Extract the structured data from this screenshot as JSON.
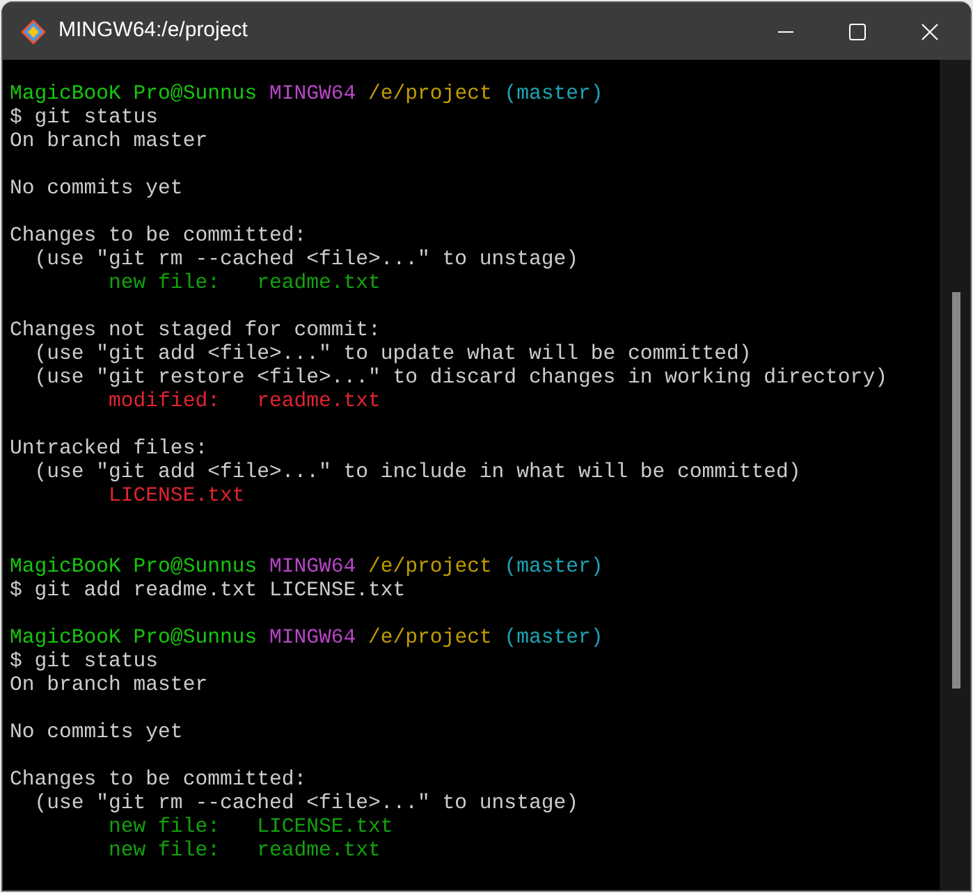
{
  "window": {
    "title": "MINGW64:/e/project"
  },
  "terminal": {
    "lines": [
      {
        "kind": "blank"
      },
      {
        "kind": "text",
        "segments": [
          {
            "text": "MagicBooK Pro@Sunnus ",
            "color": "#16c60c"
          },
          {
            "text": "MINGW64 ",
            "color": "#b845c8"
          },
          {
            "text": "/e/project ",
            "color": "#c19c00"
          },
          {
            "text": "(master)",
            "color": "#1ca3b4"
          }
        ]
      },
      {
        "kind": "text",
        "segments": [
          {
            "text": "$ git status",
            "color": "#cccccc"
          }
        ]
      },
      {
        "kind": "text",
        "segments": [
          {
            "text": "On branch master",
            "color": "#cccccc"
          }
        ]
      },
      {
        "kind": "blank"
      },
      {
        "kind": "text",
        "segments": [
          {
            "text": "No commits yet",
            "color": "#cccccc"
          }
        ]
      },
      {
        "kind": "blank"
      },
      {
        "kind": "text",
        "segments": [
          {
            "text": "Changes to be committed:",
            "color": "#cccccc"
          }
        ]
      },
      {
        "kind": "text",
        "segments": [
          {
            "text": "  (use \"git rm --cached <file>...\" to unstage)",
            "color": "#cccccc"
          }
        ]
      },
      {
        "kind": "text",
        "segments": [
          {
            "text": "        new file:   readme.txt",
            "color": "#13a10e"
          }
        ]
      },
      {
        "kind": "blank"
      },
      {
        "kind": "text",
        "segments": [
          {
            "text": "Changes not staged for commit:",
            "color": "#cccccc"
          }
        ]
      },
      {
        "kind": "text",
        "segments": [
          {
            "text": "  (use \"git add <file>...\" to update what will be committed)",
            "color": "#cccccc"
          }
        ]
      },
      {
        "kind": "text",
        "segments": [
          {
            "text": "  (use \"git restore <file>...\" to discard changes in working directory)",
            "color": "#cccccc"
          }
        ]
      },
      {
        "kind": "text",
        "segments": [
          {
            "text": "        modified:   readme.txt",
            "color": "#e0242f"
          }
        ]
      },
      {
        "kind": "blank"
      },
      {
        "kind": "text",
        "segments": [
          {
            "text": "Untracked files:",
            "color": "#cccccc"
          }
        ]
      },
      {
        "kind": "text",
        "segments": [
          {
            "text": "  (use \"git add <file>...\" to include in what will be committed)",
            "color": "#cccccc"
          }
        ]
      },
      {
        "kind": "text",
        "segments": [
          {
            "text": "        LICENSE.txt",
            "color": "#e0242f"
          }
        ]
      },
      {
        "kind": "blank"
      },
      {
        "kind": "blank"
      },
      {
        "kind": "text",
        "segments": [
          {
            "text": "MagicBooK Pro@Sunnus ",
            "color": "#16c60c"
          },
          {
            "text": "MINGW64 ",
            "color": "#b845c8"
          },
          {
            "text": "/e/project ",
            "color": "#c19c00"
          },
          {
            "text": "(master)",
            "color": "#1ca3b4"
          }
        ]
      },
      {
        "kind": "text",
        "segments": [
          {
            "text": "$ git add readme.txt LICENSE.txt",
            "color": "#cccccc"
          }
        ]
      },
      {
        "kind": "blank"
      },
      {
        "kind": "text",
        "segments": [
          {
            "text": "MagicBooK Pro@Sunnus ",
            "color": "#16c60c"
          },
          {
            "text": "MINGW64 ",
            "color": "#b845c8"
          },
          {
            "text": "/e/project ",
            "color": "#c19c00"
          },
          {
            "text": "(master)",
            "color": "#1ca3b4"
          }
        ]
      },
      {
        "kind": "text",
        "segments": [
          {
            "text": "$ git status",
            "color": "#cccccc"
          }
        ]
      },
      {
        "kind": "text",
        "segments": [
          {
            "text": "On branch master",
            "color": "#cccccc"
          }
        ]
      },
      {
        "kind": "blank"
      },
      {
        "kind": "text",
        "segments": [
          {
            "text": "No commits yet",
            "color": "#cccccc"
          }
        ]
      },
      {
        "kind": "blank"
      },
      {
        "kind": "text",
        "segments": [
          {
            "text": "Changes to be committed:",
            "color": "#cccccc"
          }
        ]
      },
      {
        "kind": "text",
        "segments": [
          {
            "text": "  (use \"git rm --cached <file>...\" to unstage)",
            "color": "#cccccc"
          }
        ]
      },
      {
        "kind": "text",
        "segments": [
          {
            "text": "        new file:   LICENSE.txt",
            "color": "#13a10e"
          }
        ]
      },
      {
        "kind": "text",
        "segments": [
          {
            "text": "        new file:   readme.txt",
            "color": "#13a10e"
          }
        ]
      }
    ]
  }
}
